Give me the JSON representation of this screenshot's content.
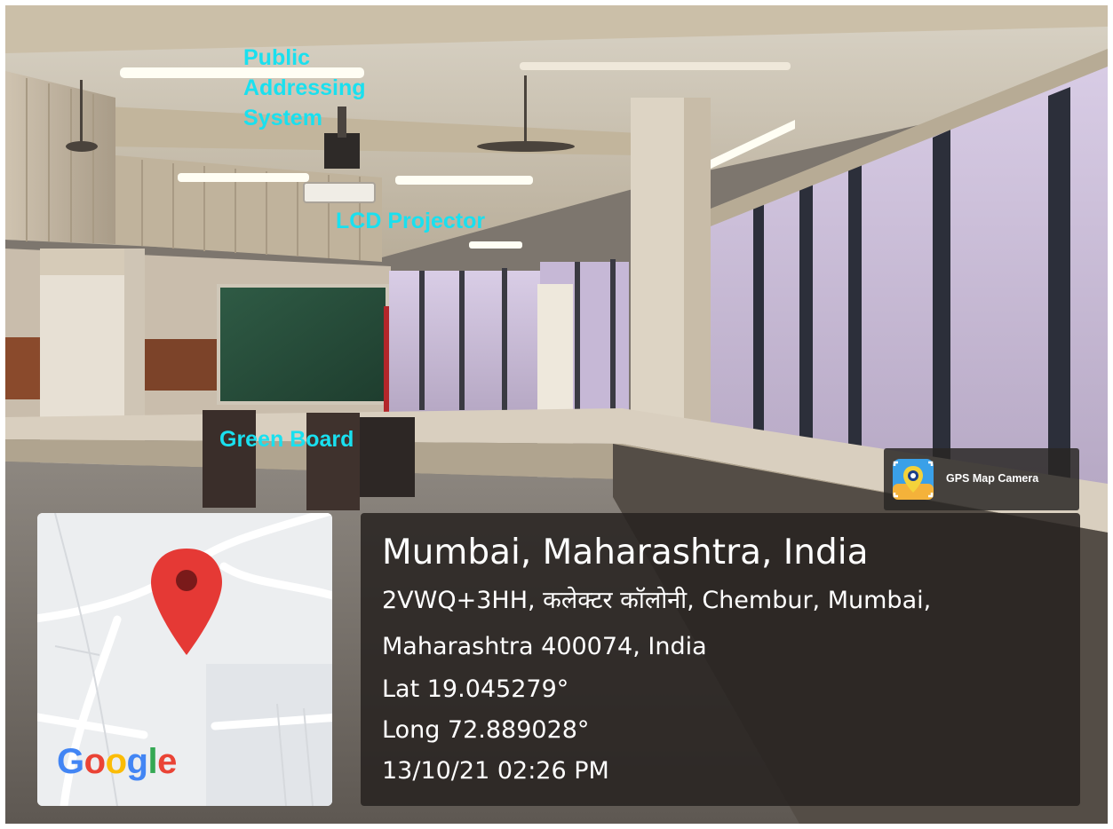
{
  "annotations": {
    "public_addressing": "Public\nAddressing\nSystem",
    "lcd_projector": "LCD Projector",
    "green_board": "Green Board"
  },
  "location": {
    "title": "Mumbai, Maharashtra, India",
    "address_line_1": "2VWQ+3HH, कलेक्टर कॉलोनी, Chembur, Mumbai,",
    "address_line_2": "Maharashtra 400074, India",
    "latitude": "Lat 19.045279°",
    "longitude": "Long 72.889028°",
    "datetime": "13/10/21 02:26 PM"
  },
  "map": {
    "logo_letters": [
      {
        "ch": "G",
        "color": "#4285F4"
      },
      {
        "ch": "o",
        "color": "#EA4335"
      },
      {
        "ch": "o",
        "color": "#FBBC05"
      },
      {
        "ch": "g",
        "color": "#4285F4"
      },
      {
        "ch": "l",
        "color": "#34A853"
      },
      {
        "ch": "e",
        "color": "#EA4335"
      }
    ],
    "pin_color": "#E53935",
    "pin_icon": "map-pin-icon"
  },
  "app_badge": {
    "label": "GPS Map Camera",
    "icon": "gps-map-camera-icon"
  },
  "colors": {
    "annotation_text": "#19e0ef",
    "panel_background": "#262220"
  }
}
